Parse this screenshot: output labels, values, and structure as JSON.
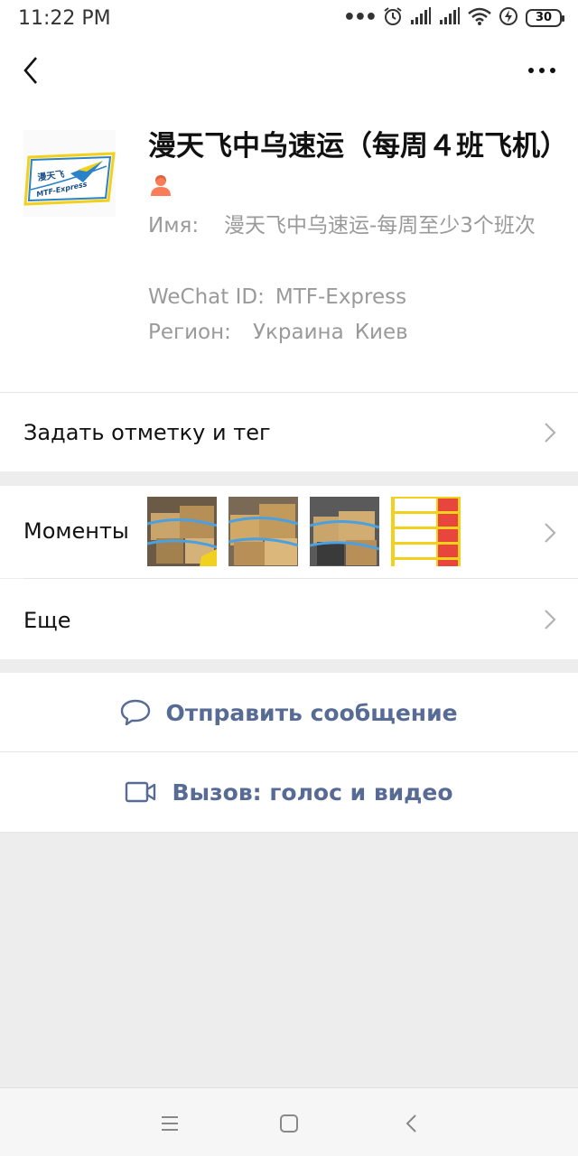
{
  "status_bar": {
    "time": "11:22 PM",
    "battery": "30",
    "icons": [
      "more-dots-icon",
      "alarm-icon",
      "signal-icon",
      "signal-icon",
      "wifi-icon",
      "charging-icon",
      "battery-icon"
    ]
  },
  "nav": {
    "back_icon": "chevron-left-icon",
    "more_icon": "more-horizontal-icon"
  },
  "profile": {
    "title": "漫天飞中乌速运（每周４班飞机）",
    "gender_icon": "female-person-icon",
    "avatar_logo": "漫天飞",
    "avatar_logo_sub": "MTF-Express",
    "name_label": "Имя:",
    "name_value": "漫天飞中乌速运-每周至少3个班次",
    "wechat_label": "WeChat ID:",
    "wechat_value": "MTF-Express",
    "region_label": "Регион:",
    "region_country": "Украина",
    "region_city": "Киев"
  },
  "menu": {
    "set_remark": "Задать отметку и тег",
    "moments": "Моменты",
    "more": "Еще"
  },
  "actions": {
    "send_message": "Отправить сообщение",
    "call": "Вызов: голос и видео"
  },
  "colors": {
    "link": "#576b95",
    "background": "#ededed",
    "female_icon": "#fa7d5a"
  }
}
